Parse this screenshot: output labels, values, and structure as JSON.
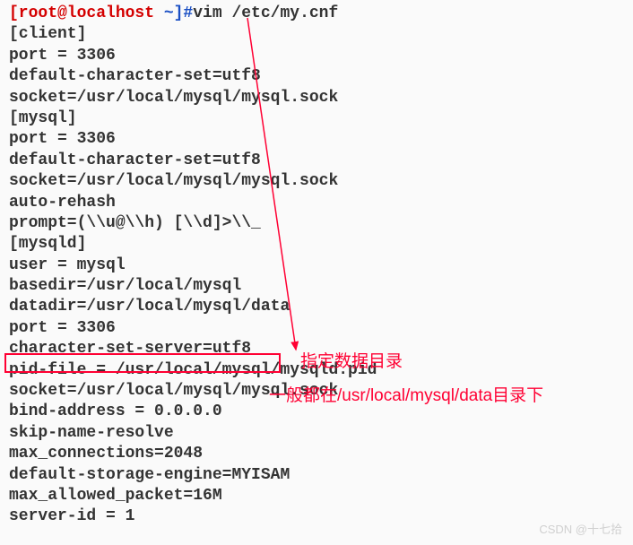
{
  "prompt": {
    "user_host": "[root@localhost",
    "tilde": " ~]#",
    "command": "vim /etc/my.cnf"
  },
  "lines": {
    "l0": "",
    "l1": "[client]",
    "l2": "port = 3306",
    "l3": "default-character-set=utf8",
    "l4": "socket=/usr/local/mysql/mysql.sock",
    "l5": "",
    "l6": "[mysql]",
    "l7": "port = 3306",
    "l8": "default-character-set=utf8",
    "l9": "socket=/usr/local/mysql/mysql.sock",
    "l10": "auto-rehash",
    "l11": "prompt=(\\\\u@\\\\h) [\\\\d]>\\\\_",
    "l12": "",
    "l13": "[mysqld]",
    "l14": "user = mysql",
    "l15": "basedir=/usr/local/mysql",
    "l16": "datadir=/usr/local/mysql/data",
    "l17": "port = 3306",
    "l18": "character-set-server=utf8",
    "l19": "pid-file = /usr/local/mysql/mysqld.pid",
    "l20": "socket=/usr/local/mysql/mysql.sock",
    "l21": "bind-address = 0.0.0.0",
    "l22": "skip-name-resolve",
    "l23": "max_connections=2048",
    "l24": "default-storage-engine=MYISAM",
    "l25": "max_allowed_packet=16M",
    "l26": "server-id = 1"
  },
  "annotations": {
    "label1": "指定数据目录",
    "label2": "一般都在/usr/local/mysql/data目录下"
  },
  "watermark": "CSDN @十七拾"
}
